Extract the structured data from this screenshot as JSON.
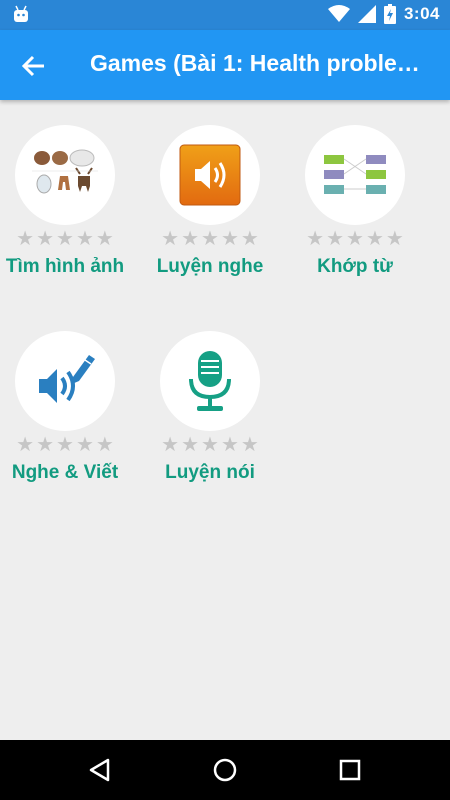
{
  "status_bar": {
    "time": "3:04",
    "icons": [
      "android-icon",
      "wifi-icon",
      "signal-icon",
      "battery-icon"
    ]
  },
  "app_bar": {
    "back_icon": "arrow-left-icon",
    "title": "Games (Bài 1: Health proble…"
  },
  "games": [
    {
      "label": "Tìm hình ảnh",
      "icon": "animals-picture-icon",
      "stars_max": 5,
      "stars_filled": 0
    },
    {
      "label": "Luyện nghe",
      "icon": "speaker-icon",
      "stars_max": 5,
      "stars_filled": 0
    },
    {
      "label": "Khớp từ",
      "icon": "match-words-icon",
      "stars_max": 5,
      "stars_filled": 0
    },
    {
      "label": "Nghe & Viết",
      "icon": "listen-write-icon",
      "stars_max": 5,
      "stars_filled": 0
    },
    {
      "label": "Luyện nói",
      "icon": "microphone-icon",
      "stars_max": 5,
      "stars_filled": 0
    }
  ],
  "nav_bar": {
    "icons": [
      "back-triangle-icon",
      "home-circle-icon",
      "recents-square-icon"
    ]
  },
  "colors": {
    "status_bar": "#2a86d6",
    "app_bar": "#2196f3",
    "label_green": "#129b80",
    "background": "#eeeeee",
    "star_empty": "#c6c6c6"
  }
}
